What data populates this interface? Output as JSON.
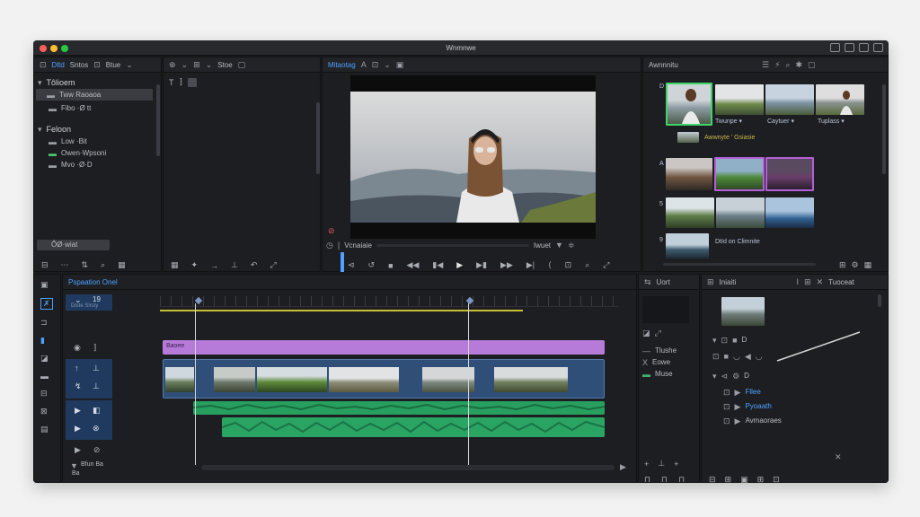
{
  "window": {
    "title": "Wnmnwe",
    "traffic_colors": [
      "#ff5f57",
      "#febc2e",
      "#28c840"
    ]
  },
  "media_browser": {
    "tabs": [
      "Dltd",
      "Sntos",
      "Btue"
    ],
    "groups": [
      {
        "label": "Tôlioem",
        "items": [
          "Tww Raoaoa",
          "Fibo ·Ø tt"
        ]
      },
      {
        "label": "Feloon",
        "items": [
          "Low ·Bit",
          "Owen·Wpsoni",
          "Mvo ·Ø·D"
        ]
      }
    ],
    "search_value": "ÔØ·wiat"
  },
  "effects_panel": {
    "tab": "Stoe"
  },
  "viewer": {
    "tab": "Mitaotag",
    "timecode_label": "Vcnaiaie",
    "fit_label": "Iwuet"
  },
  "browser": {
    "tab": "Awnnnitu",
    "collection_label": "Awwnyte ' Gsiasie",
    "captions": [
      "Twunpe ▾",
      "Caytuer ▾",
      "Tuplass ▾"
    ],
    "row_labels": [
      "D",
      "A",
      "5",
      "9"
    ],
    "bottom_label": "DtId on Climnite"
  },
  "timeline": {
    "tab": "Pspaation Onel",
    "track_number": "19",
    "track_sub": "Diste Slrsty",
    "title_clip": "Baoee",
    "bottom_label": "Bfun Ba",
    "bottom_sub": "Ba"
  },
  "audio_panel": {
    "tab": "Uort",
    "items": [
      "Tlushe",
      "Eowe",
      "Muse"
    ]
  },
  "inspector": {
    "tab": "Iniaiti",
    "tab2": "Tuoceat",
    "labels": [
      "D",
      "D"
    ],
    "items": [
      "Fllee",
      "Pyoaath",
      "Avmaoraes"
    ]
  },
  "colors": {
    "accent": "#4ea1ff",
    "purple_clip": "#b67bd8",
    "audio_green": "#27a05f",
    "video_clip": "#3c5f8a",
    "playhead": "#d6d6d6",
    "selection_green": "#3fd46a",
    "selection_purple": "#b45ed8"
  }
}
